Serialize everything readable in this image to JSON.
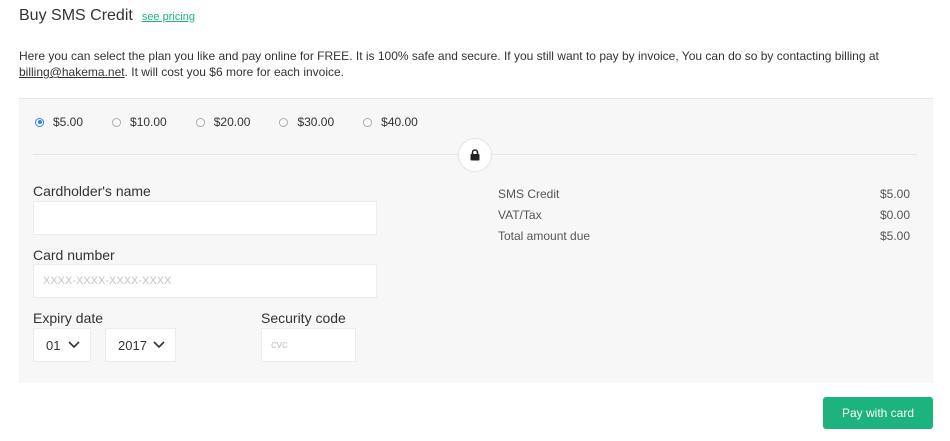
{
  "header": {
    "title": "Buy SMS Credit",
    "pricing_link": "see pricing"
  },
  "intro": {
    "text": "Here you can select the plan you like and pay online for FREE. It is 100% safe and secure. If you still want to pay by invoice, You can do so by contacting billing at ",
    "email": "billing@hakema.net",
    "text_after": ". It will cost you $6 more for each invoice."
  },
  "plans": [
    {
      "label": "$5.00",
      "selected": true
    },
    {
      "label": "$10.00",
      "selected": false
    },
    {
      "label": "$20.00",
      "selected": false
    },
    {
      "label": "$30.00",
      "selected": false
    },
    {
      "label": "$40.00",
      "selected": false
    }
  ],
  "form": {
    "cardholder_label": "Cardholder's name",
    "cardholder_value": "",
    "card_number_label": "Card number",
    "card_number_placeholder": "XXXX-XXXX-XXXX-XXXX",
    "expiry_label": "Expiry date",
    "expiry_month": "01",
    "expiry_year": "2017",
    "security_label": "Security code",
    "security_placeholder": "cvc"
  },
  "summary": [
    {
      "label": "SMS Credit",
      "value": "$5.00"
    },
    {
      "label": "VAT/Tax",
      "value": "$0.00"
    },
    {
      "label": "Total amount due",
      "value": "$5.00"
    }
  ],
  "pay_button": "Pay with card",
  "colors": {
    "accent": "#1db37d",
    "radio_selected": "#2f80ed",
    "panel_bg": "#f7f7f7"
  }
}
